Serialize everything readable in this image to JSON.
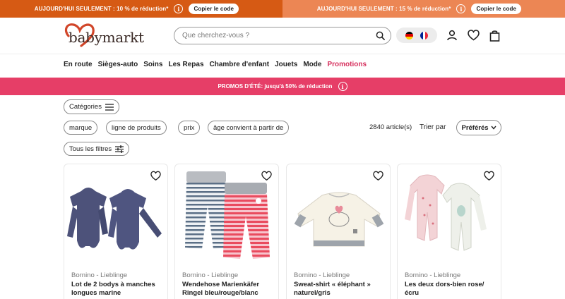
{
  "promo_top": {
    "left_text": "AUJOURD'HUI SEULEMENT : 10 % de réduction*",
    "right_text": "AUJOURD'HUI SEULEMENT : 15 % de réduction*",
    "info_glyph": "i",
    "copy_label": "Copier le code",
    "colors": {
      "left": "#d65a14",
      "right": "#ec8654"
    }
  },
  "header": {
    "logo_text": "babymarkt",
    "search_placeholder": "Que cherchez-vous ?",
    "languages": [
      "de-flag-icon",
      "fr-flag-icon"
    ],
    "icons": [
      "account-icon",
      "wishlist-heart-icon",
      "shopping-bag-icon"
    ]
  },
  "nav": {
    "items": [
      "En route",
      "Sièges-auto",
      "Soins",
      "Les Repas",
      "Chambre d'enfant",
      "Jouets",
      "Mode",
      "Promotions"
    ],
    "accent": "#d6315e"
  },
  "banner": {
    "text": "PROMOS D'ÉTÉ: jusqu'à 50% de réduction",
    "color": "#e63e67"
  },
  "filters": {
    "categories_label": "Catégories",
    "chips": [
      "marque",
      "ligne de produits",
      "prix",
      "âge convient à partir de"
    ],
    "all_filters_label": "Tous les filtres",
    "count_text": "2840 article(s)",
    "sort_label": "Trier par",
    "sort_value": "Préférés"
  },
  "products": [
    {
      "brand": "Bornino - Lieblinge",
      "title": "Lot de 2 bodys à manches longues marine"
    },
    {
      "brand": "Bornino - Lieblinge",
      "title": "Wendehose Marienkäfer Ringel bleu/rouge/blanc"
    },
    {
      "brand": "Bornino - Lieblinge",
      "title": "Sweat-shirt « éléphant » naturel/gris"
    },
    {
      "brand": "Bornino - Lieblinge",
      "title": "Les deux dors-bien rose/ écru"
    }
  ]
}
